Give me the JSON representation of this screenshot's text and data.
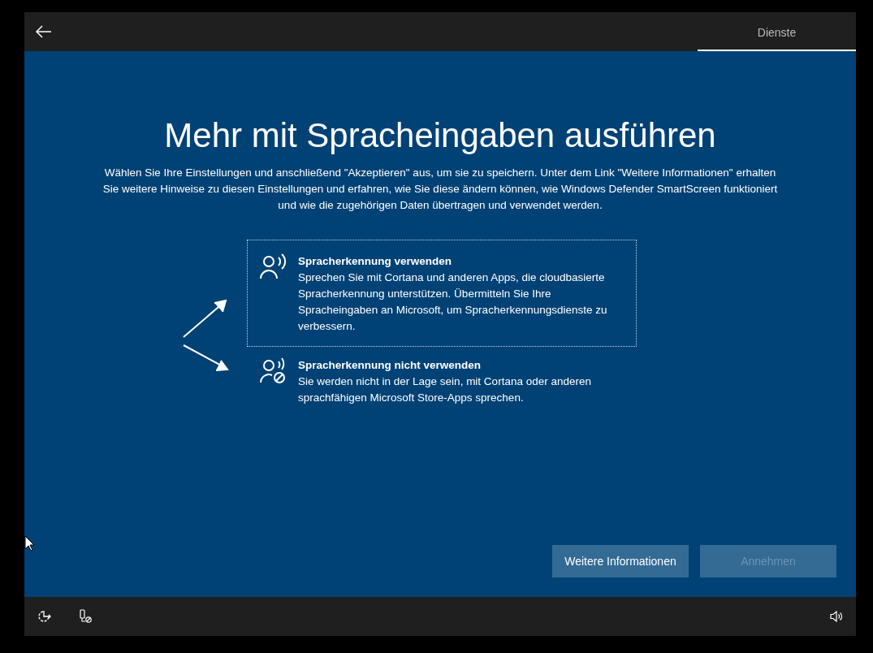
{
  "top_bar": {
    "tab": {
      "label": "Dienste",
      "selected": true
    }
  },
  "title": "Mehr mit Spracheingaben ausführen",
  "intro": "Wählen Sie Ihre Einstellungen und anschließend \"Akzeptieren\" aus, um sie zu speichern. Unter dem Link \"Weitere Informationen\" erhalten Sie weitere Hinweise zu diesen Einstellungen und erfahren, wie Sie diese ändern können, wie Windows Defender SmartScreen funktioniert und wie die zugehörigen Daten übertragen und verwendet werden.",
  "options": [
    {
      "kind": "on",
      "selected": true,
      "title": "Spracherkennung verwenden",
      "description": "Sprechen Sie mit Cortana und anderen Apps, die cloudbasierte Spracherkennung unterstützen. Übermitteln Sie Ihre Spracheingaben an Microsoft, um Spracherkennungsdienste zu verbessern."
    },
    {
      "kind": "off",
      "selected": false,
      "title": "Spracherkennung nicht verwenden",
      "description": "Sie werden nicht in der Lage sein, mit Cortana oder anderen sprachfähigen Microsoft Store-Apps sprechen."
    }
  ],
  "buttons": [
    {
      "label": "Weitere Informationen",
      "disabled": false
    },
    {
      "label": "Annehmen",
      "disabled": true
    }
  ]
}
